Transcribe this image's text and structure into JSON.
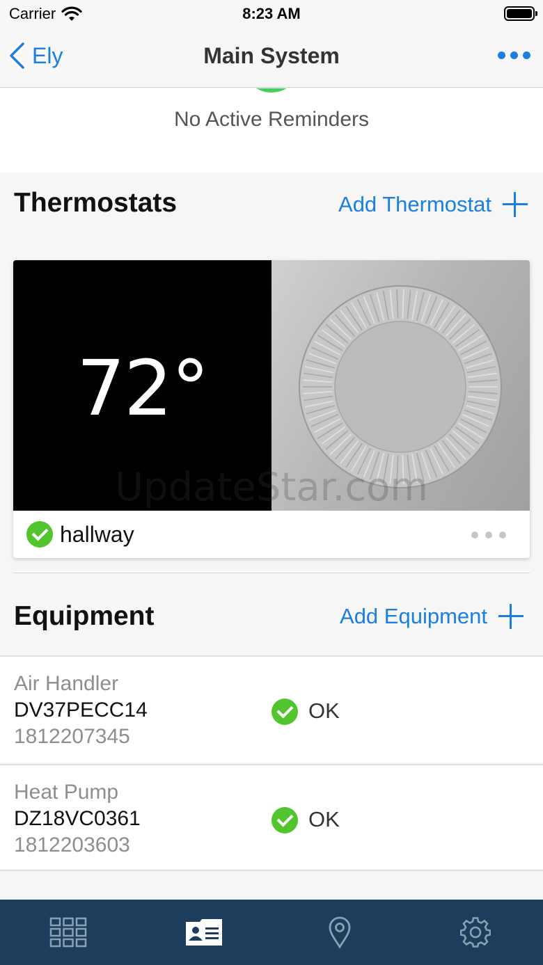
{
  "status_bar": {
    "carrier": "Carrier",
    "time": "8:23 AM"
  },
  "nav": {
    "back_label": "Ely",
    "title": "Main System"
  },
  "reminders": {
    "text": "No Active Reminders"
  },
  "thermostats": {
    "title": "Thermostats",
    "add_label": "Add Thermostat",
    "items": [
      {
        "temperature": "72°",
        "name": "hallway"
      }
    ]
  },
  "watermark": "UpdateStar.com",
  "equipment": {
    "title": "Equipment",
    "add_label": "Add Equipment",
    "items": [
      {
        "type": "Air Handler",
        "model": "DV37PECC14",
        "serial": "1812207345",
        "status": "OK"
      },
      {
        "type": "Heat Pump",
        "model": "DZ18VC0361",
        "serial": "1812203603",
        "status": "OK"
      }
    ]
  },
  "tab_bar": {
    "tabs": [
      {
        "icon": "grid-icon"
      },
      {
        "icon": "profile-card-icon",
        "active": true
      },
      {
        "icon": "location-pin-icon"
      },
      {
        "icon": "gear-icon"
      }
    ]
  },
  "colors": {
    "accent": "#1a7fe0",
    "ok_green": "#52c42e",
    "tab_bar_bg": "#1c3d5c"
  }
}
